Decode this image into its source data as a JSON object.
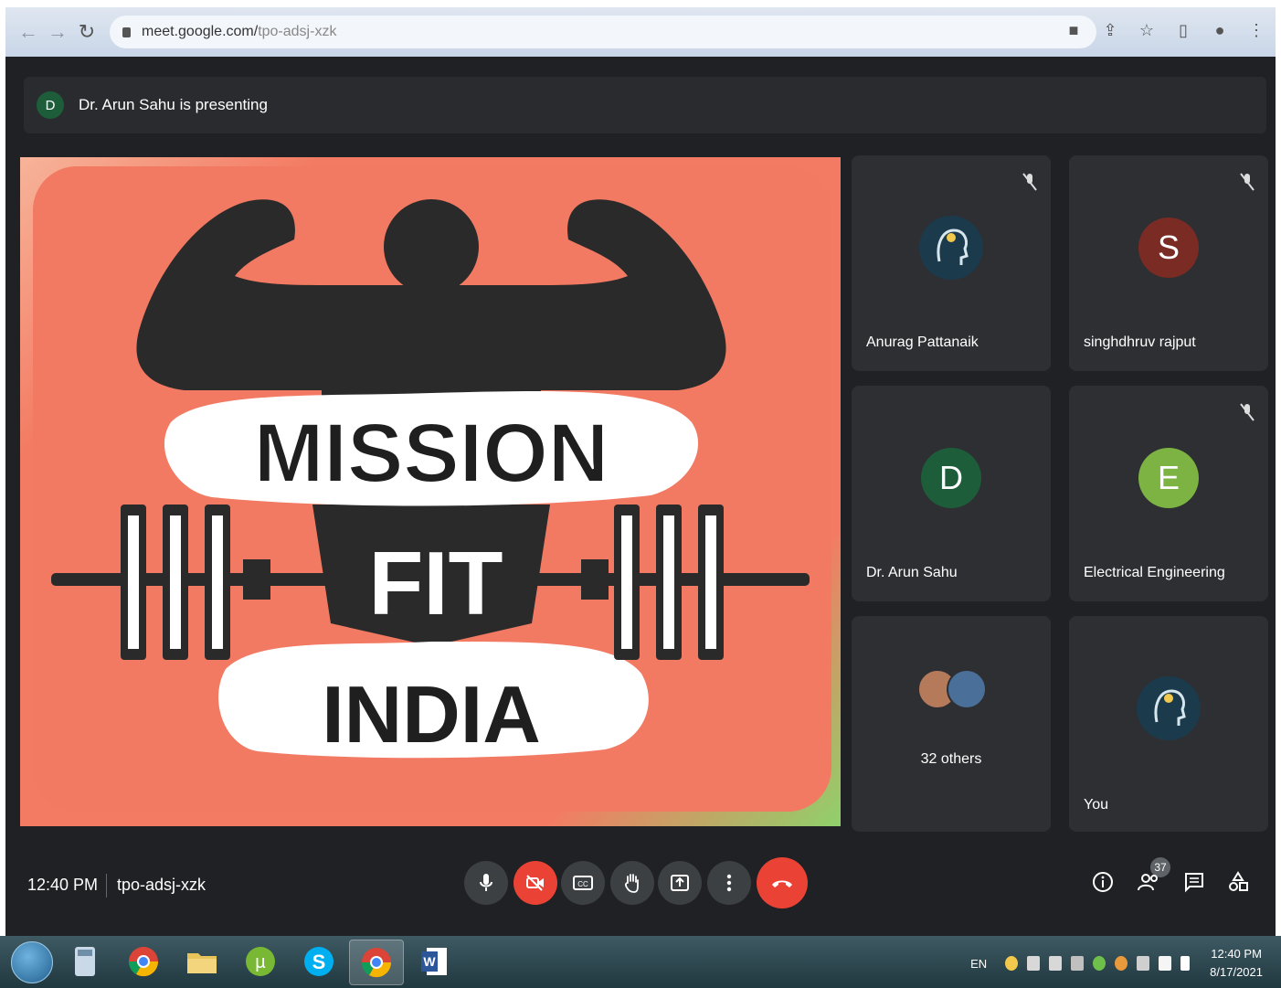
{
  "browser": {
    "url_host": "meet.google.com/",
    "url_path": "tpo-adsj-xzk",
    "back_icon": "arrow-left-icon",
    "forward_icon": "arrow-right-icon",
    "reload_icon": "reload-icon"
  },
  "meet": {
    "presenter_initial": "D",
    "presenting_text": "Dr. Arun Sahu is presenting",
    "slide": {
      "line1": "MISSION",
      "line2": "FIT",
      "line3": "INDIA"
    },
    "participants": [
      {
        "name": "Anurag Pattanaik",
        "initial": "",
        "muted": true,
        "avatar_color": "#1b3a4b"
      },
      {
        "name": "singhdhruv rajput",
        "initial": "S",
        "muted": true,
        "avatar_color": "#7a2b23"
      },
      {
        "name": "Dr. Arun Sahu",
        "initial": "D",
        "muted": false,
        "avatar_color": "#1e5d3a"
      },
      {
        "name": "Electrical Engineering",
        "initial": "E",
        "muted": true,
        "avatar_color": "#7cb342"
      },
      {
        "name": "32 others",
        "initial": "",
        "muted": false,
        "avatar_color": "#5a4b40"
      },
      {
        "name": "You",
        "initial": "",
        "muted": false,
        "avatar_color": "#1b3a4b"
      }
    ],
    "controls": {
      "time": "12:40 PM",
      "meeting_code": "tpo-adsj-xzk",
      "people_count": "37"
    }
  },
  "taskbar": {
    "language": "EN",
    "time": "12:40 PM",
    "date": "8/17/2021"
  }
}
